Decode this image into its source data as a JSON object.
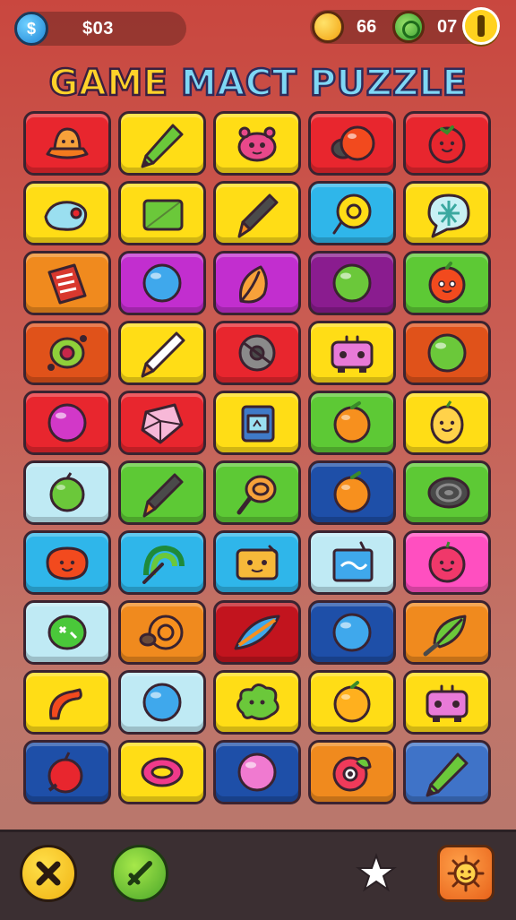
{
  "hud": {
    "money": "$03",
    "money_icon": "dollar-coin-icon",
    "coins": "66",
    "gems": "07",
    "coin_icon": "gold-coin-icon",
    "gem_icon": "green-gem-icon",
    "menu_icon": "pause-icon"
  },
  "title": {
    "part1": "GAME",
    "part2": "MACT PUZZLE"
  },
  "board": {
    "columns": 5,
    "rows": 10,
    "tiles": [
      {
        "icon": "hat",
        "color": "#e8262e"
      },
      {
        "icon": "pencil",
        "color": "#ffdd16"
      },
      {
        "icon": "crab",
        "color": "#ffdd16"
      },
      {
        "icon": "ball-pair",
        "color": "#e8262e"
      },
      {
        "icon": "tomato",
        "color": "#e8262e"
      },
      {
        "icon": "fish",
        "color": "#ffdd16"
      },
      {
        "icon": "card",
        "color": "#ffdd16"
      },
      {
        "icon": "brush",
        "color": "#ffdd16"
      },
      {
        "icon": "donut",
        "color": "#2fb6ea"
      },
      {
        "icon": "speech-bubble",
        "color": "#ffdd16"
      },
      {
        "icon": "book",
        "color": "#f08a1e"
      },
      {
        "icon": "blue-ball",
        "color": "#c22ecf"
      },
      {
        "icon": "leaf",
        "color": "#c22ecf"
      },
      {
        "icon": "green-ball",
        "color": "#8a1c8f"
      },
      {
        "icon": "face-fruit",
        "color": "#5dc935"
      },
      {
        "icon": "olive",
        "color": "#e0521a"
      },
      {
        "icon": "pen",
        "color": "#ffdd16"
      },
      {
        "icon": "gear",
        "color": "#e8262e"
      },
      {
        "icon": "robot",
        "color": "#ffdd16"
      },
      {
        "icon": "green-ball",
        "color": "#e0521a"
      },
      {
        "icon": "magenta-ball",
        "color": "#e8262e"
      },
      {
        "icon": "gem",
        "color": "#e8262e"
      },
      {
        "icon": "box",
        "color": "#ffdd16"
      },
      {
        "icon": "orange",
        "color": "#5dc935"
      },
      {
        "icon": "lemon-face",
        "color": "#ffdd16"
      },
      {
        "icon": "apple",
        "color": "#bfeaf4"
      },
      {
        "icon": "brush",
        "color": "#5dc935"
      },
      {
        "icon": "seed",
        "color": "#5dc935"
      },
      {
        "icon": "orange",
        "color": "#1e4fa8"
      },
      {
        "icon": "snail",
        "color": "#5dc935"
      },
      {
        "icon": "strawberry",
        "color": "#2fb6ea"
      },
      {
        "icon": "rainbow",
        "color": "#2fb6ea"
      },
      {
        "icon": "cheese",
        "color": "#2fb6ea"
      },
      {
        "icon": "milk-box",
        "color": "#bfeaf4"
      },
      {
        "icon": "berry-face",
        "color": "#ff4fc0"
      },
      {
        "icon": "melon",
        "color": "#bfeaf4"
      },
      {
        "icon": "snail-shell",
        "color": "#f08a1e"
      },
      {
        "icon": "surfboard",
        "color": "#c2141e"
      },
      {
        "icon": "blue-ball",
        "color": "#1e4fa8"
      },
      {
        "icon": "leaf-brush",
        "color": "#f08a1e"
      },
      {
        "icon": "chili",
        "color": "#ffdd16"
      },
      {
        "icon": "blue-ball",
        "color": "#bfeaf4"
      },
      {
        "icon": "bush",
        "color": "#ffdd16"
      },
      {
        "icon": "peach",
        "color": "#ffdd16"
      },
      {
        "icon": "robot",
        "color": "#ffdd16"
      },
      {
        "icon": "apple-red",
        "color": "#1e4fa8"
      },
      {
        "icon": "ring",
        "color": "#ffdd16"
      },
      {
        "icon": "pink-ball",
        "color": "#1e4fa8"
      },
      {
        "icon": "eye-fruit",
        "color": "#f08a1e"
      },
      {
        "icon": "pencil",
        "color": "#3f73c8"
      }
    ]
  },
  "bottom": {
    "close_icon": "close-icon",
    "sword_icon": "sword-icon",
    "star_icon": "star-icon",
    "sun_icon": "sun-icon"
  }
}
